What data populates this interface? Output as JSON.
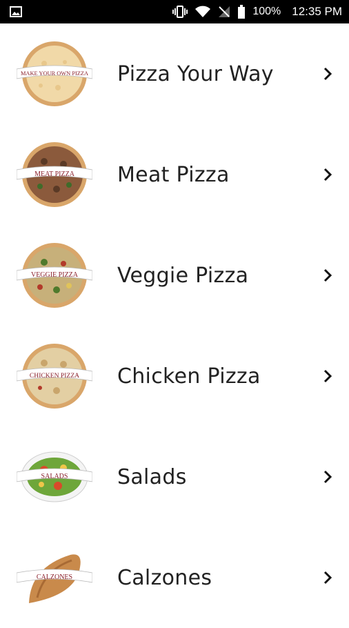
{
  "status_bar": {
    "battery": "100%",
    "time": "12:35 PM"
  },
  "menu": [
    {
      "label": "Pizza Your Way",
      "banner": "MAKE YOUR OWN PIZZA",
      "kind": "pizza",
      "topping": "#f1d9a8"
    },
    {
      "label": "Meat Pizza",
      "banner": "MEAT PIZZA",
      "kind": "pizza",
      "topping": "#6d4a35"
    },
    {
      "label": "Veggie Pizza",
      "banner": "VEGGIE PIZZA",
      "kind": "pizza",
      "topping": "#c7b07a"
    },
    {
      "label": "Chicken Pizza",
      "banner": "CHICKEN PIZZA",
      "kind": "pizza",
      "topping": "#e3cfa3"
    },
    {
      "label": "Salads",
      "banner": "SALADS",
      "kind": "salad",
      "topping": "#6ea63a"
    },
    {
      "label": "Calzones",
      "banner": "CALZONES",
      "kind": "calzone",
      "topping": "#c98a4b"
    }
  ],
  "colors": {
    "banner_text": "#8a1f2a",
    "crust": "#d9a66a",
    "label_text": "#222222"
  }
}
